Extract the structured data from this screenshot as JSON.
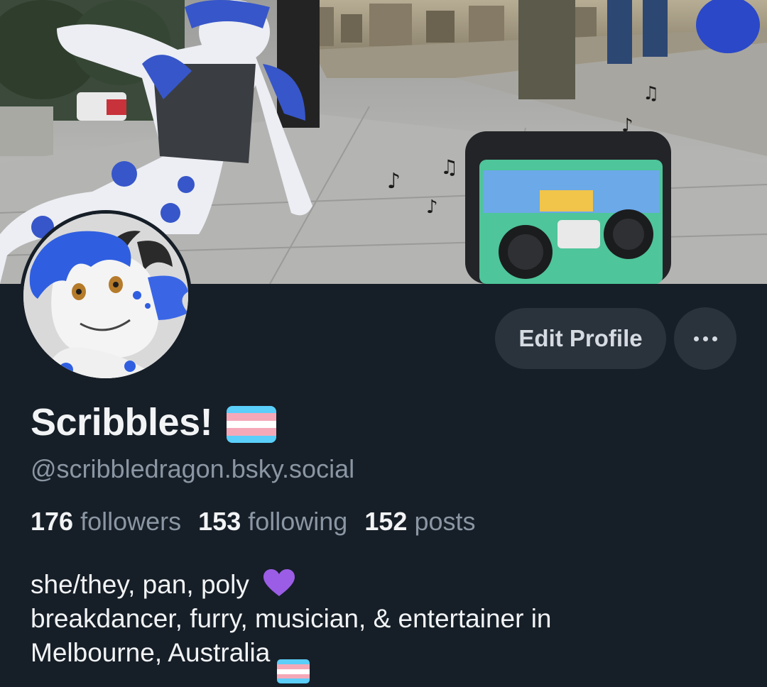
{
  "profile": {
    "display_name": "Scribbles!",
    "handle": "@scribbledragon.bsky.social",
    "name_flag_icon": "transgender-flag-icon",
    "stats": {
      "followers_count": "176",
      "followers_label": "followers",
      "following_count": "153",
      "following_label": "following",
      "posts_count": "152",
      "posts_label": "posts"
    },
    "bio": {
      "line1": "she/they, pan, poly",
      "line1_icon": "purple-heart-icon",
      "line2": "breakdancer, furry, musician, & entertainer in",
      "line3": "Melbourne, Australia",
      "line3_icon": "transgender-flag-icon"
    }
  },
  "actions": {
    "edit_label": "Edit Profile",
    "more_icon": "ellipsis-icon"
  },
  "colors": {
    "background": "#161e27",
    "button_bg": "#2a323c",
    "text_primary": "#f1f3f5",
    "text_secondary": "#8a96a3",
    "flag_blue": "#5bcefa",
    "flag_pink": "#f5a9b8",
    "heart_purple": "#9b5de5"
  }
}
